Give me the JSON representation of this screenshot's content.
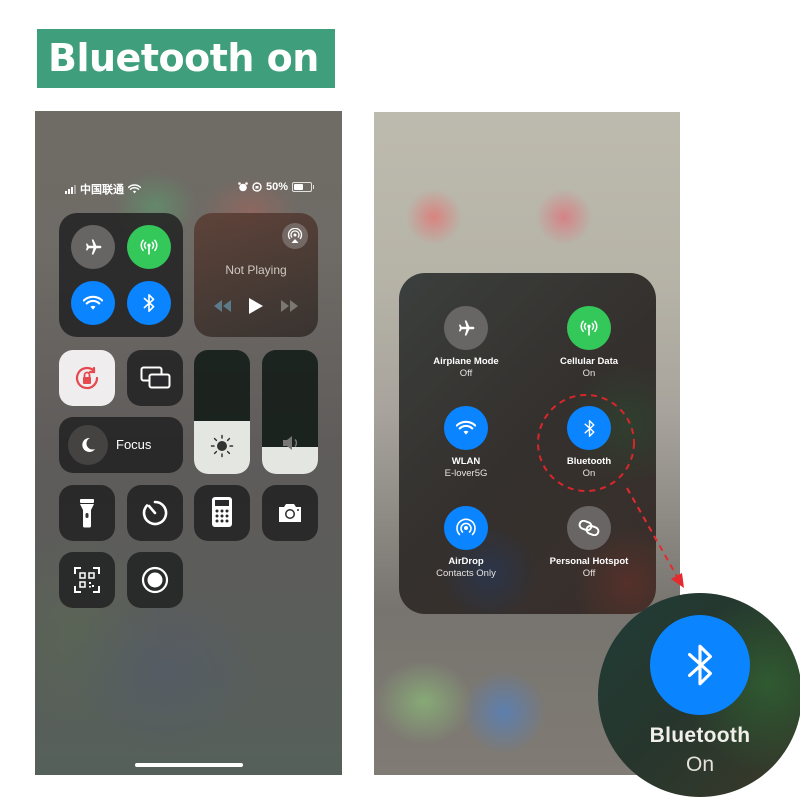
{
  "banner": {
    "title": "Bluetooth on",
    "color": "#3f9e7c"
  },
  "left_screen": {
    "status_bar": {
      "carrier": "中国联通",
      "battery_percent": "50%"
    },
    "media": {
      "label": "Not Playing"
    },
    "focus": {
      "label": "Focus"
    },
    "brightness_level": 0.43,
    "volume_level": 0.22,
    "connectivity": [
      {
        "name": "airplane-mode",
        "state": "off"
      },
      {
        "name": "cellular-data",
        "state": "on"
      },
      {
        "name": "wlan",
        "state": "on"
      },
      {
        "name": "bluetooth",
        "state": "on"
      }
    ]
  },
  "right_screen": {
    "items": [
      {
        "title": "Airplane Mode",
        "status": "Off",
        "color": "#6e6c6a"
      },
      {
        "title": "Cellular Data",
        "status": "On",
        "color": "#34c759"
      },
      {
        "title": "WLAN",
        "status": "E-lover5G",
        "color": "#0a84ff"
      },
      {
        "title": "Bluetooth",
        "status": "On",
        "color": "#0a84ff"
      },
      {
        "title": "AirDrop",
        "status": "Contacts Only",
        "color": "#0a84ff"
      },
      {
        "title": "Personal Hotspot",
        "status": "Off",
        "color": "#6e6c6a"
      }
    ]
  },
  "zoom_callout": {
    "title": "Bluetooth",
    "status": "On",
    "highlight_color": "#d9262a"
  }
}
